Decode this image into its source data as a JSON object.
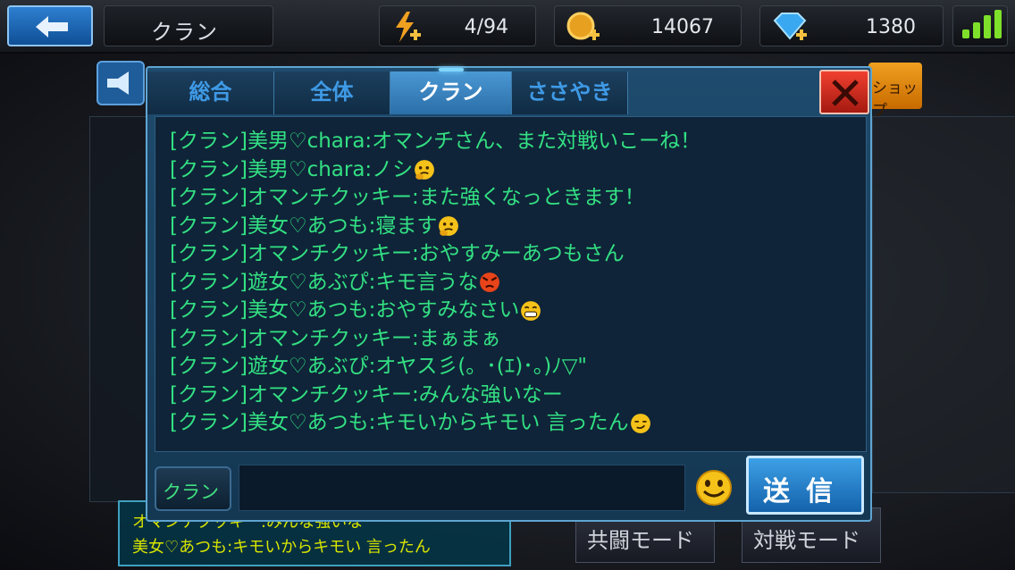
{
  "topbar": {
    "title": "クラン",
    "stamina": "4/94",
    "coins": "14067",
    "gems": "1380"
  },
  "background": {
    "shop_label": "ショップ",
    "coop_mode": "共闘モード",
    "battle_mode": "対戦モード",
    "ticker_lines": [
      "オマンチクッキー:みんな強いなー",
      "美女♡あつも:キモいからキモい 言ったん"
    ]
  },
  "chat": {
    "tabs": [
      "総合",
      "全体",
      "クラン",
      "ささやき"
    ],
    "active_tab": 2,
    "messages": [
      {
        "text": "[クラン]美男♡chara:オマンチさん、また対戦いこーね！",
        "emoji": ""
      },
      {
        "text": "[クラン]美男♡chara:ノシ",
        "emoji": "thinking-emoji"
      },
      {
        "text": "[クラン]オマンチクッキー:また強くなっときます！",
        "emoji": ""
      },
      {
        "text": "[クラン]美女♡あつも:寝ます",
        "emoji": "thinking-emoji"
      },
      {
        "text": "[クラン]オマンチクッキー:おやすみーあつもさん",
        "emoji": ""
      },
      {
        "text": "[クラン]遊女♡あぶぴ:キモ言うな",
        "emoji": "angry-emoji"
      },
      {
        "text": "[クラン]美女♡あつも:おやすみなさい",
        "emoji": "grin-emoji"
      },
      {
        "text": "[クラン]オマンチクッキー:まぁまぁ",
        "emoji": ""
      },
      {
        "text": "[クラン]遊女♡あぶぴ:オヤス彡(。･(ｴ)･。)ﾉ▽\"",
        "emoji": ""
      },
      {
        "text": "[クラン]オマンチクッキー:みんな強いなー",
        "emoji": ""
      },
      {
        "text": "[クラン]美女♡あつも:キモいからキモい 言ったん",
        "emoji": "smirk-emoji"
      }
    ],
    "channel_label": "クラン",
    "input_value": "",
    "send_label": "送信"
  },
  "colors": {
    "chat_text": "#33e083",
    "active_tab": "#4a98d4",
    "close_red": "#e03a2a",
    "signal_green": "#7ee02a"
  }
}
